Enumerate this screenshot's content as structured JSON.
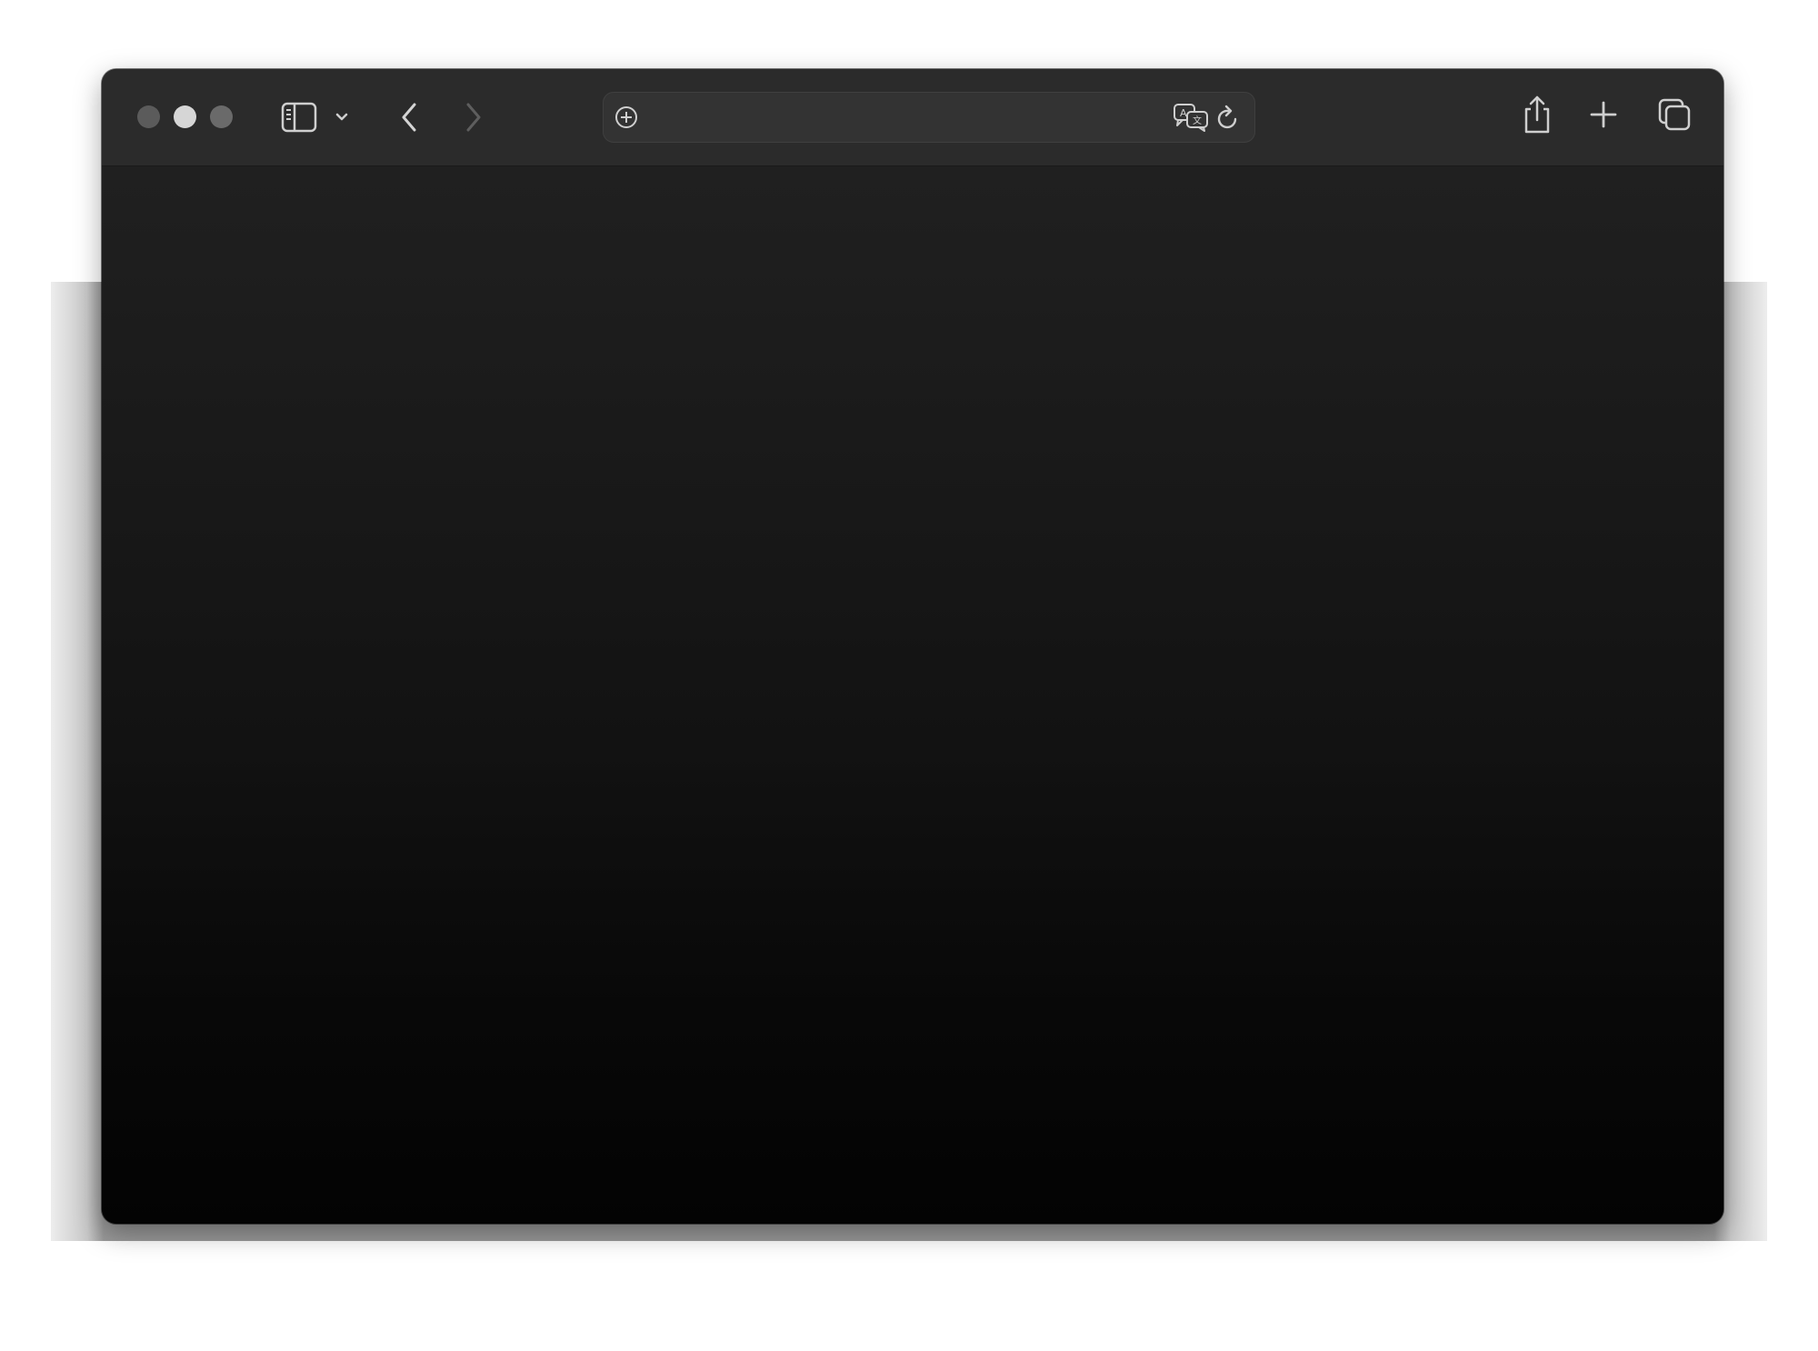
{
  "window": {
    "controls": {
      "close_color": "#5b5b5b",
      "minimize_color": "#d6d6d6",
      "zoom_color": "#6a6a6a"
    },
    "toolbar": {
      "sidebar_icon": "sidebar-icon",
      "sidebar_menu_icon": "chevron-down-icon",
      "back_icon": "chevron-left-icon",
      "forward_icon": "chevron-right-icon",
      "share_icon": "share-icon",
      "new_tab_icon": "plus-icon",
      "tab_overview_icon": "tab-overview-icon"
    },
    "address_bar": {
      "value": "",
      "left_icon": "add-circle-icon",
      "translate_icon": "translate-icon",
      "reload_icon": "reload-icon"
    },
    "content": {
      "background_top": "#202020",
      "background_bottom": "#030303"
    }
  }
}
